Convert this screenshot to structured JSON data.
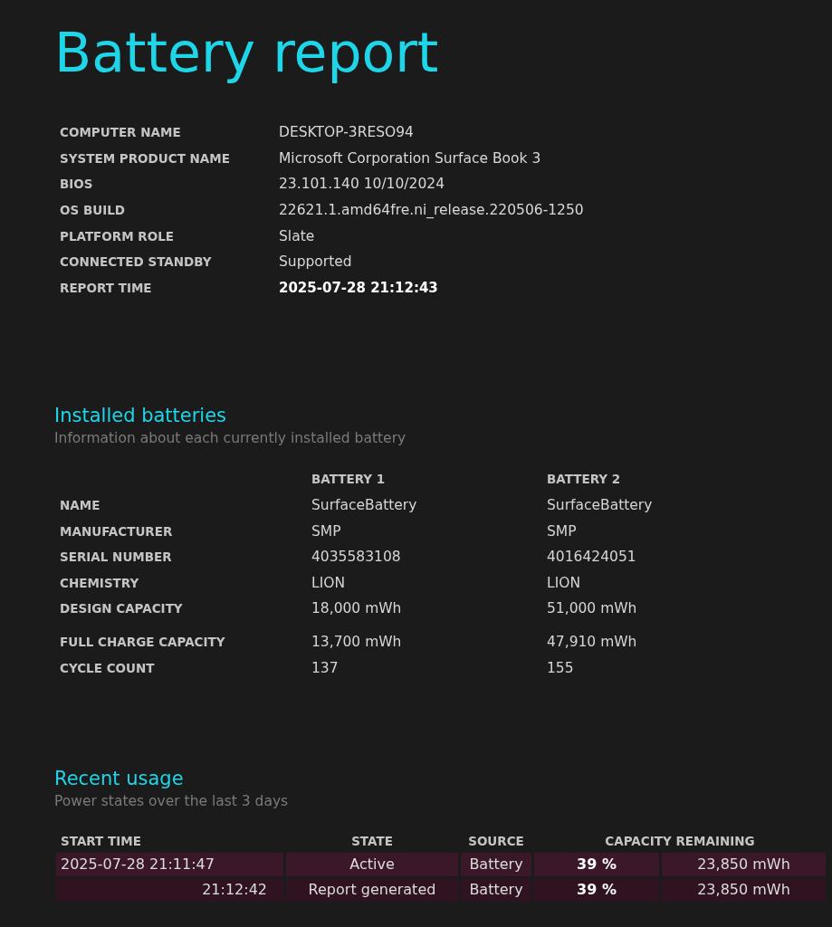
{
  "title": "Battery report",
  "system_info": [
    {
      "label": "COMPUTER NAME",
      "value": "DESKTOP-3RESO94"
    },
    {
      "label": "SYSTEM PRODUCT NAME",
      "value": "Microsoft Corporation Surface Book 3"
    },
    {
      "label": "BIOS",
      "value": "23.101.140 10/10/2024"
    },
    {
      "label": "OS BUILD",
      "value": "22621.1.amd64fre.ni_release.220506-1250"
    },
    {
      "label": "PLATFORM ROLE",
      "value": "Slate"
    },
    {
      "label": "CONNECTED STANDBY",
      "value": "Supported"
    },
    {
      "label": "REPORT TIME",
      "value": "2025-07-28  21:12:43"
    }
  ],
  "installed_batteries": {
    "heading": "Installed batteries",
    "subtitle": "Information about each currently installed battery",
    "columns": [
      "BATTERY 1",
      "BATTERY 2"
    ],
    "rows": [
      {
        "label": "NAME",
        "values": [
          "SurfaceBattery",
          "SurfaceBattery"
        ]
      },
      {
        "label": "MANUFACTURER",
        "values": [
          "SMP",
          "SMP"
        ]
      },
      {
        "label": "SERIAL NUMBER",
        "values": [
          "4035583108",
          "4016424051"
        ]
      },
      {
        "label": "CHEMISTRY",
        "values": [
          "LION",
          "LION"
        ]
      },
      {
        "label": "DESIGN CAPACITY",
        "values": [
          "18,000 mWh",
          "51,000 mWh"
        ]
      },
      {
        "label": "FULL CHARGE CAPACITY",
        "values": [
          "13,700 mWh",
          "47,910 mWh"
        ]
      },
      {
        "label": "CYCLE COUNT",
        "values": [
          "137",
          "155"
        ]
      }
    ]
  },
  "recent_usage": {
    "heading": "Recent usage",
    "subtitle": "Power states over the last 3 days",
    "columns": [
      "START TIME",
      "STATE",
      "SOURCE",
      "CAPACITY REMAINING"
    ],
    "rows": [
      {
        "start_time": "2025-07-28  21:11:47",
        "state": "Active",
        "source": "Battery",
        "percent": "39 %",
        "capacity": "23,850 mWh"
      },
      {
        "start_time": "21:12:42",
        "state": "Report generated",
        "source": "Battery",
        "percent": "39 %",
        "capacity": "23,850 mWh"
      }
    ]
  }
}
